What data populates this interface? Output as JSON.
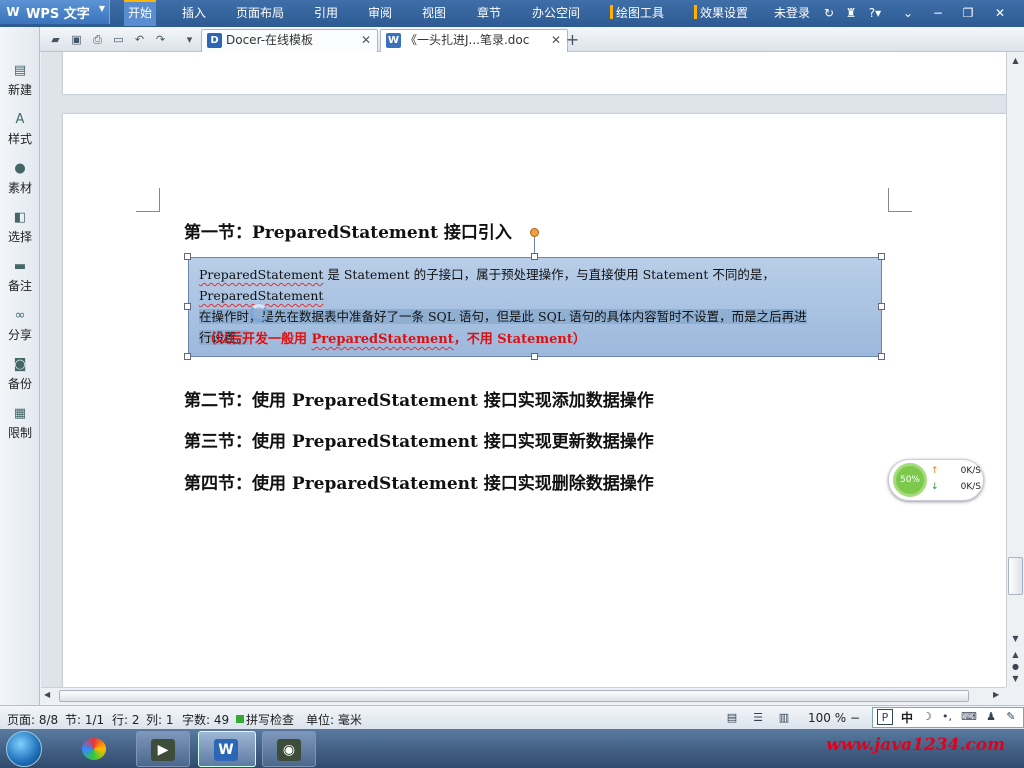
{
  "app": {
    "name": "WPS 文字",
    "logo_letter": "W"
  },
  "menu": {
    "items": [
      "开始",
      "插入",
      "页面布局",
      "引用",
      "审阅",
      "视图",
      "章节",
      "办公空间"
    ],
    "tools": [
      "绘图工具",
      "效果设置"
    ],
    "login": "未登录",
    "help": "?"
  },
  "tabs": [
    {
      "title": "Docer-在线模板",
      "icon": "D"
    },
    {
      "title": "《一头扎进J...笔录.doc",
      "icon": "W"
    }
  ],
  "sidebar": {
    "items": [
      {
        "label": "新建",
        "icon": "new-doc-icon"
      },
      {
        "label": "样式",
        "icon": "style-icon"
      },
      {
        "label": "素材",
        "icon": "material-icon"
      },
      {
        "label": "选择",
        "icon": "select-icon"
      },
      {
        "label": "备注",
        "icon": "comment-icon"
      },
      {
        "label": "分享",
        "icon": "share-icon"
      },
      {
        "label": "备份",
        "icon": "backup-icon"
      },
      {
        "label": "限制",
        "icon": "restrict-icon"
      }
    ]
  },
  "document": {
    "h1_prefix": "第一节：",
    "h1_eng": "PreparedStatement",
    "h1_suffix": " 接口引入",
    "para_l1_a": "PreparedStatement",
    "para_l1_b": " 是 Statement 的子接口，属于预处理操作，与直接使用 Statement 不同的是，",
    "para_l1_c": "PreparedStatement",
    "para_l2": "在操作时，是先在数据表中准备好了一条 SQL 语句，但是此 SQL 语句的具体内容暂时不设置，而是之后再进",
    "para_l3": "行设置。",
    "note_a": "（以后开发一般用 ",
    "note_b": "PreparedStatement",
    "note_c": "，不用 Statement）",
    "h2_prefix": "第二节：使用 ",
    "h2_eng": "PreparedStatement",
    "h2_suffix": " 接口实现添加数据操作",
    "h3_prefix": "第三节：使用 ",
    "h3_eng": "PreparedStatement",
    "h3_suffix": " 接口实现更新数据操作",
    "h4_prefix": "第四节：使用 ",
    "h4_eng": "PreparedStatement",
    "h4_suffix": " 接口实现删除数据操作"
  },
  "netspeed": {
    "percent": "50%",
    "up": "0K/S",
    "down": "0K/S"
  },
  "status": {
    "page": "页面: 8/8",
    "section": "节: 1/1",
    "row": "行: 2",
    "col": "列: 1",
    "words": "字数: 49",
    "spellcheck": "拼写检查",
    "unit": "单位: 毫米",
    "zoom": "100 %"
  },
  "ime": {
    "label": "中"
  },
  "watermark": "www.java1234.com",
  "colors": {
    "accent": "#2d5a93",
    "note_red": "#d11111",
    "selection": "#9cb8dc"
  }
}
